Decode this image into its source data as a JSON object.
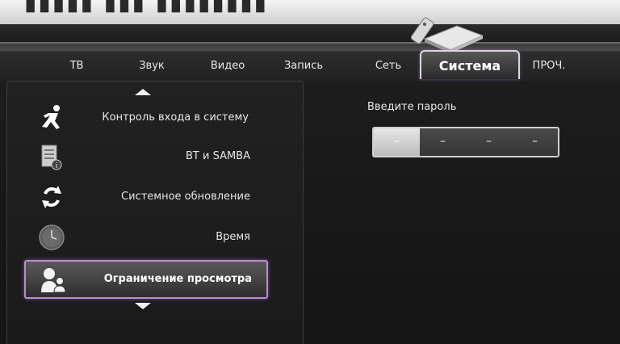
{
  "tabs": [
    {
      "label": "ТВ"
    },
    {
      "label": "Звук"
    },
    {
      "label": "Видео"
    },
    {
      "label": "Запись"
    },
    {
      "label": "Сеть"
    },
    {
      "label": "Система",
      "active": true
    },
    {
      "label": "ПРОЧ."
    }
  ],
  "menu": {
    "items": [
      {
        "label": "Контроль входа в систему",
        "icon": "running-person-icon"
      },
      {
        "label": "BT и SAMBA",
        "icon": "document-info-icon"
      },
      {
        "label": "Системное обновление",
        "icon": "refresh-arrows-icon"
      },
      {
        "label": "Время",
        "icon": "clock-icon"
      },
      {
        "label": "Ограничение просмотра",
        "icon": "parent-child-icon",
        "selected": true
      }
    ]
  },
  "password": {
    "label": "Введите пароль",
    "digits": [
      "–",
      "–",
      "–",
      "–"
    ]
  },
  "colors": {
    "accent_glow": "#b98bd0",
    "text": "#e8e8e8",
    "background": "#1a1a1a"
  }
}
